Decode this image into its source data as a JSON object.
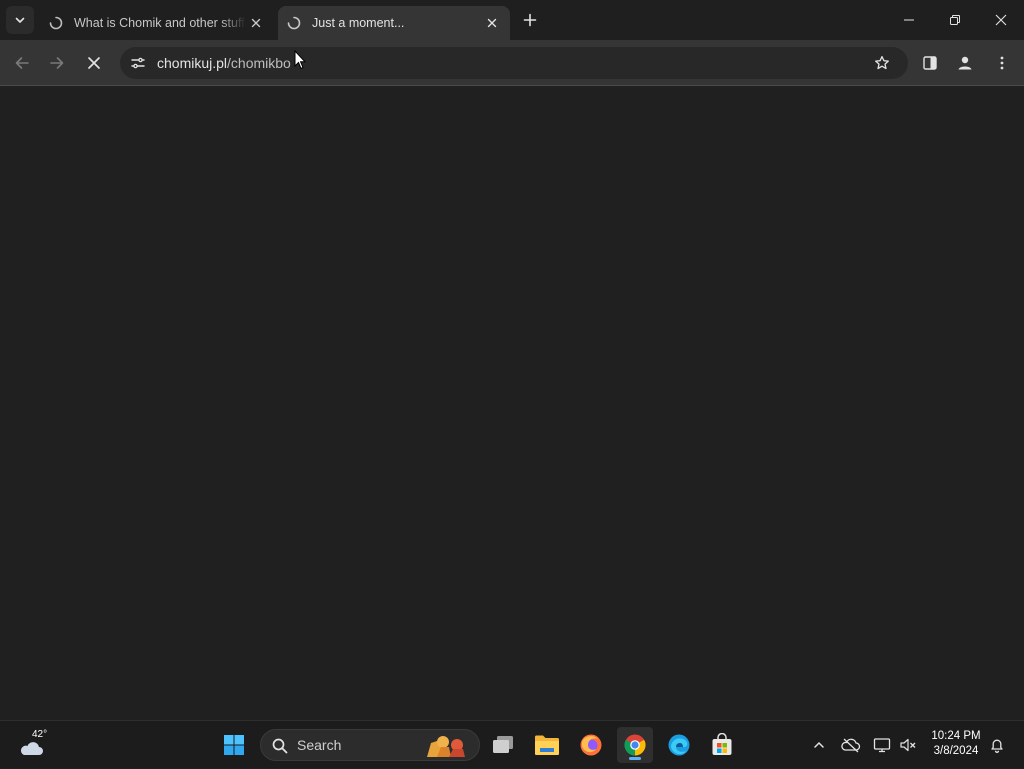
{
  "tabs": [
    {
      "title": "What is Chomik and other stuff",
      "favicon": "loading-spinner-icon",
      "active": false
    },
    {
      "title": "Just a moment...",
      "favicon": "loading-spinner-icon",
      "active": true
    }
  ],
  "toolbar": {
    "url_host": "chomikuj.pl",
    "url_path": "/chomikbo",
    "back_icon": "arrow-left-icon",
    "forward_icon": "arrow-right-icon",
    "stop_icon": "close-icon"
  },
  "taskbar": {
    "weather_temp": "42°",
    "search_label": "Search",
    "apps": [
      "start-icon",
      "search",
      "task-view-icon",
      "file-explorer-icon",
      "firefox-icon",
      "chrome-icon",
      "edge-icon",
      "microsoft-store-icon"
    ],
    "active_app": "chrome-icon"
  },
  "clock": {
    "time": "10:24 PM",
    "date": "3/8/2024"
  },
  "colors": {
    "tabstrip": "#1f1f1f",
    "toolbar": "#353535",
    "page": "#202020",
    "taskbar": "#1c1c1c",
    "accent": "#5fb2f2"
  }
}
